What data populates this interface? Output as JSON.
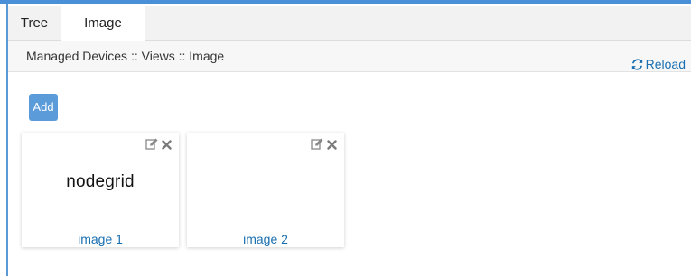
{
  "tabs": [
    {
      "label": "Tree"
    },
    {
      "label": "Image"
    }
  ],
  "breadcrumb": "Managed Devices :: Views :: Image",
  "reload_label": "Reload",
  "add_label": "Add",
  "cards": [
    {
      "logo_text": "nodegrid",
      "label": "image 1"
    },
    {
      "logo_text": "",
      "label": "image 2"
    }
  ],
  "colors": {
    "accent": "#5b9bd9",
    "link": "#1a6fb0",
    "icon": "#888888"
  }
}
